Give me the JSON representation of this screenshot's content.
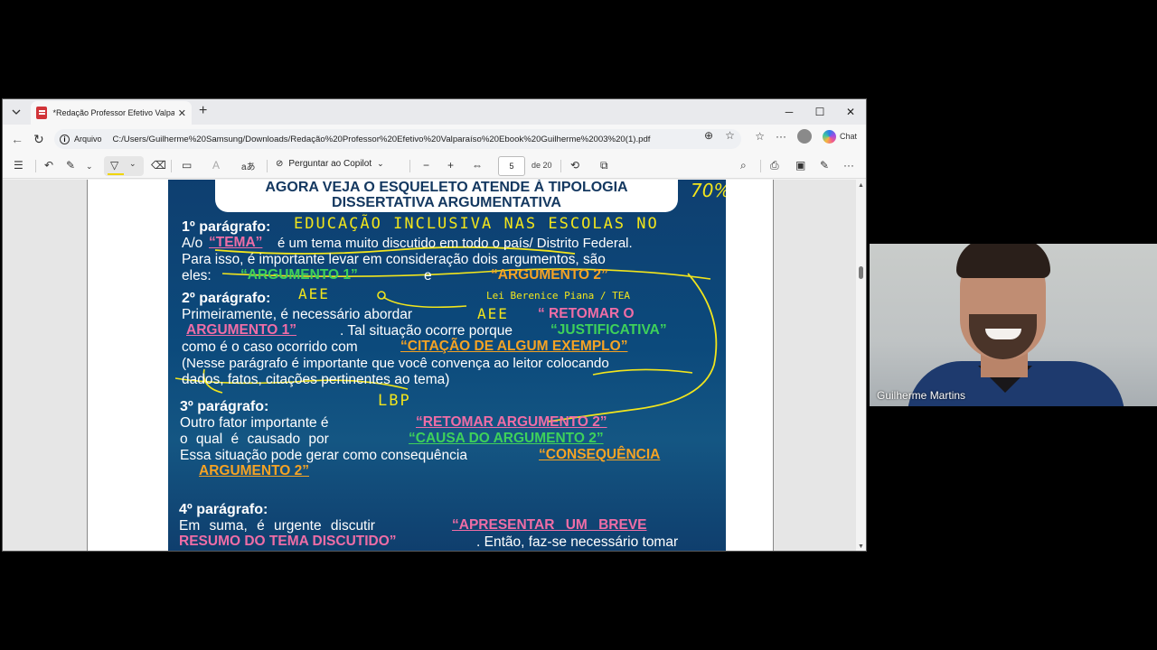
{
  "browser": {
    "tab_title": "*Redação Professor Efetivo Valparaíso",
    "address_label": "Arquivo",
    "url": "C:/Users/Guilherme%20Samsung/Downloads/Redação%20Professor%20Efetivo%20Valparaíso%20Ebook%20Guilherme%2003%20(1).pdf",
    "chat_label": "Chat"
  },
  "pdf_toolbar": {
    "ask_copilot": "Perguntar ao Copilot",
    "page_current": "5",
    "page_total": "de 20"
  },
  "slide": {
    "heading_line1": "AGORA VEJA O ESQUELETO ATENDE À TIPOLOGIA",
    "heading_line2": "DISSERTATIVA ARGUMENTATIVA",
    "pct": "70%",
    "p1_heading": "1º parágrafo:",
    "p1_hand": "EDUCAÇÃO INCLUSIVA NAS ESCOLAS NO",
    "p1_l1_a": "A/o",
    "p1_l1_tema": "“TEMA”",
    "p1_l1_b": "é um tema muito discutido em todo o país/ Distrito Federal.",
    "p1_l2": "Para isso, é importante levar em consideração dois argumentos, são",
    "p1_l3_a": "eles:",
    "p1_arg1": "“ARGUMENTO 1”",
    "p1_l3_e": "e",
    "p1_arg2": "“ARGUMENTO 2”",
    "p2_heading": "2º parágrafo:",
    "p2_hand1": "AEE",
    "p2_hand2": "Lei Berenice Piana / TEA",
    "p2_l1": "Primeiramente, é necessário abordar",
    "p2_hand3": "AEE",
    "p2_retomar": "“ RETOMAR O",
    "p2_arg1": "ARGUMENTO 1”",
    "p2_l2_b": ". Tal situação ocorre porque",
    "p2_just": "“JUSTIFICATIVA”",
    "p2_l3_a": "como é o caso ocorrido com",
    "p2_cit": "“CITAÇÃO DE ALGUM EXEMPLO”",
    "p2_l4": "(Nesse parágrafo é importante que você convença ao leitor colocando",
    "p2_l5": "dados, fatos, citações pertinentes ao tema)",
    "p3_heading": "3º parágrafo:",
    "p3_hand": "LBP",
    "p3_l1": "Outro fator importante é",
    "p3_retomar": "“RETOMAR ARGUMENTO 2”",
    "p3_l2": "o qual é causado por",
    "p3_causa": "“CAUSA DO ARGUMENTO 2”",
    "p3_l3": "Essa situação pode gerar como consequência",
    "p3_cons": "“CONSEQUÊNCIA",
    "p3_arg2": "ARGUMENTO 2”",
    "p4_heading": "4º parágrafo:",
    "p4_l1": "Em suma, é urgente discutir",
    "p4_apres": "“APRESENTAR UM BREVE",
    "p4_resumo": "RESUMO DO TEMA DISCUTIDO”",
    "p4_l2_b": ". Então, faz-se necessário tomar"
  },
  "webcam": {
    "participant_name": "Guilherme Martins"
  }
}
